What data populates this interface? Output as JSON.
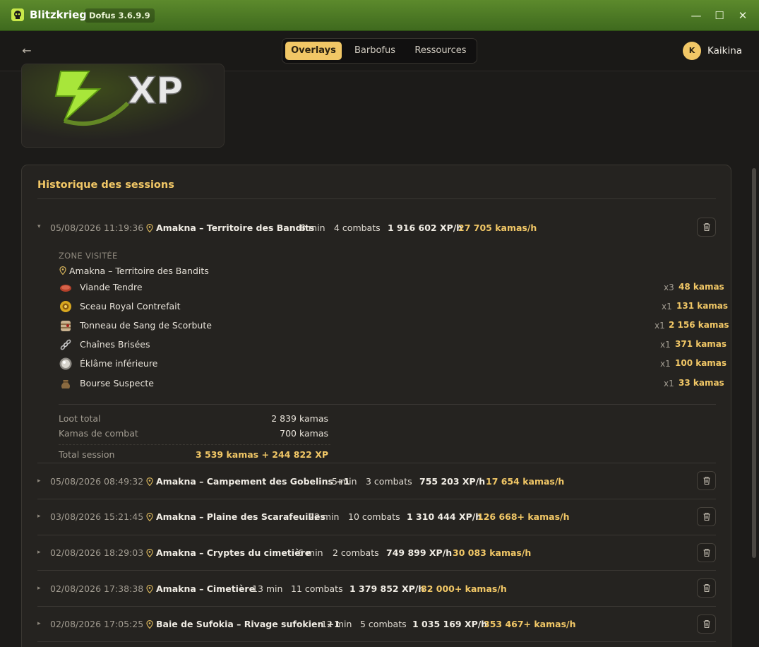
{
  "app": {
    "name": "Blitzkrieg",
    "version": "Dofus 3.6.9.9"
  },
  "window": {
    "minimize_glyph": "—",
    "maximize_glyph": "☐",
    "close_glyph": "✕"
  },
  "nav": {
    "back_glyph": "←",
    "tabs": [
      {
        "label": "Overlays",
        "active": true
      },
      {
        "label": "Barbofus",
        "active": false
      },
      {
        "label": "Ressources",
        "active": false
      }
    ]
  },
  "user": {
    "initial": "K",
    "name": "Kaikina"
  },
  "banner": {
    "logo_text": "XP"
  },
  "history": {
    "title": "Historique des sessions",
    "expanded": {
      "chevron": "▾",
      "date": "05/08/2026 11:19:36",
      "zone": "Amakna – Territoire des Bandits",
      "duration": "8 min",
      "fights": "4 combats",
      "xp_rate": "1 916 602 XP/h",
      "kamas_rate": "27 705 kamas/h",
      "zone_visited_label": "ZONE VISITÉE",
      "zone_visited": "Amakna – Territoire des Bandits",
      "loot": [
        {
          "name": "Viande Tendre",
          "qty": "x3",
          "kamas": "48 kamas",
          "icon": "meat-icon"
        },
        {
          "name": "Sceau Royal Contrefait",
          "qty": "x1",
          "kamas": "131 kamas",
          "icon": "seal-icon"
        },
        {
          "name": "Tonneau de Sang de Scorbute",
          "qty": "x1",
          "kamas": "2 156 kamas",
          "icon": "barrel-icon"
        },
        {
          "name": "Chaînes Brisées",
          "qty": "x1",
          "kamas": "371 kamas",
          "icon": "chain-icon"
        },
        {
          "name": "Éklâme inférieure",
          "qty": "x1",
          "kamas": "100 kamas",
          "icon": "orb-icon"
        },
        {
          "name": "Bourse Suspecte",
          "qty": "x1",
          "kamas": "33 kamas",
          "icon": "pouch-icon"
        }
      ],
      "totals": {
        "loot_label": "Loot total",
        "loot_value": "2 839 kamas",
        "fight_label": "Kamas de combat",
        "fight_value": "700 kamas",
        "session_label": "Total session",
        "session_value": "3 539 kamas + 244 822 XP"
      }
    },
    "sessions": [
      {
        "chevron": "▸",
        "date": "05/08/2026 08:49:32",
        "zone": "Amakna – Campement des Gobelins +1",
        "duration": "5 min",
        "fights": "3 combats",
        "xp_rate": "755 203 XP/h",
        "kamas_rate": "17 654 kamas/h"
      },
      {
        "chevron": "▸",
        "date": "03/08/2026 15:21:45",
        "zone": "Amakna – Plaine des Scarafeuilles",
        "duration": "22 min",
        "fights": "10 combats",
        "xp_rate": "1 310 444 XP/h",
        "kamas_rate": "126 668+ kamas/h"
      },
      {
        "chevron": "▸",
        "date": "02/08/2026 18:29:03",
        "zone": "Amakna – Cryptes du cimetière",
        "duration": "6 min",
        "fights": "2 combats",
        "xp_rate": "749 899 XP/h",
        "kamas_rate": "30 083 kamas/h"
      },
      {
        "chevron": "▸",
        "date": "02/08/2026 17:38:38",
        "zone": "Amakna – Cimetière",
        "duration": "13 min",
        "fights": "11 combats",
        "xp_rate": "1 379 852 XP/h",
        "kamas_rate": "82 000+ kamas/h"
      },
      {
        "chevron": "▸",
        "date": "02/08/2026 17:05:25",
        "zone": "Baie de Sufokia – Rivage sufokien +1",
        "duration": "12 min",
        "fights": "5 combats",
        "xp_rate": "1 035 169 XP/h",
        "kamas_rate": "353 467+ kamas/h"
      }
    ]
  }
}
